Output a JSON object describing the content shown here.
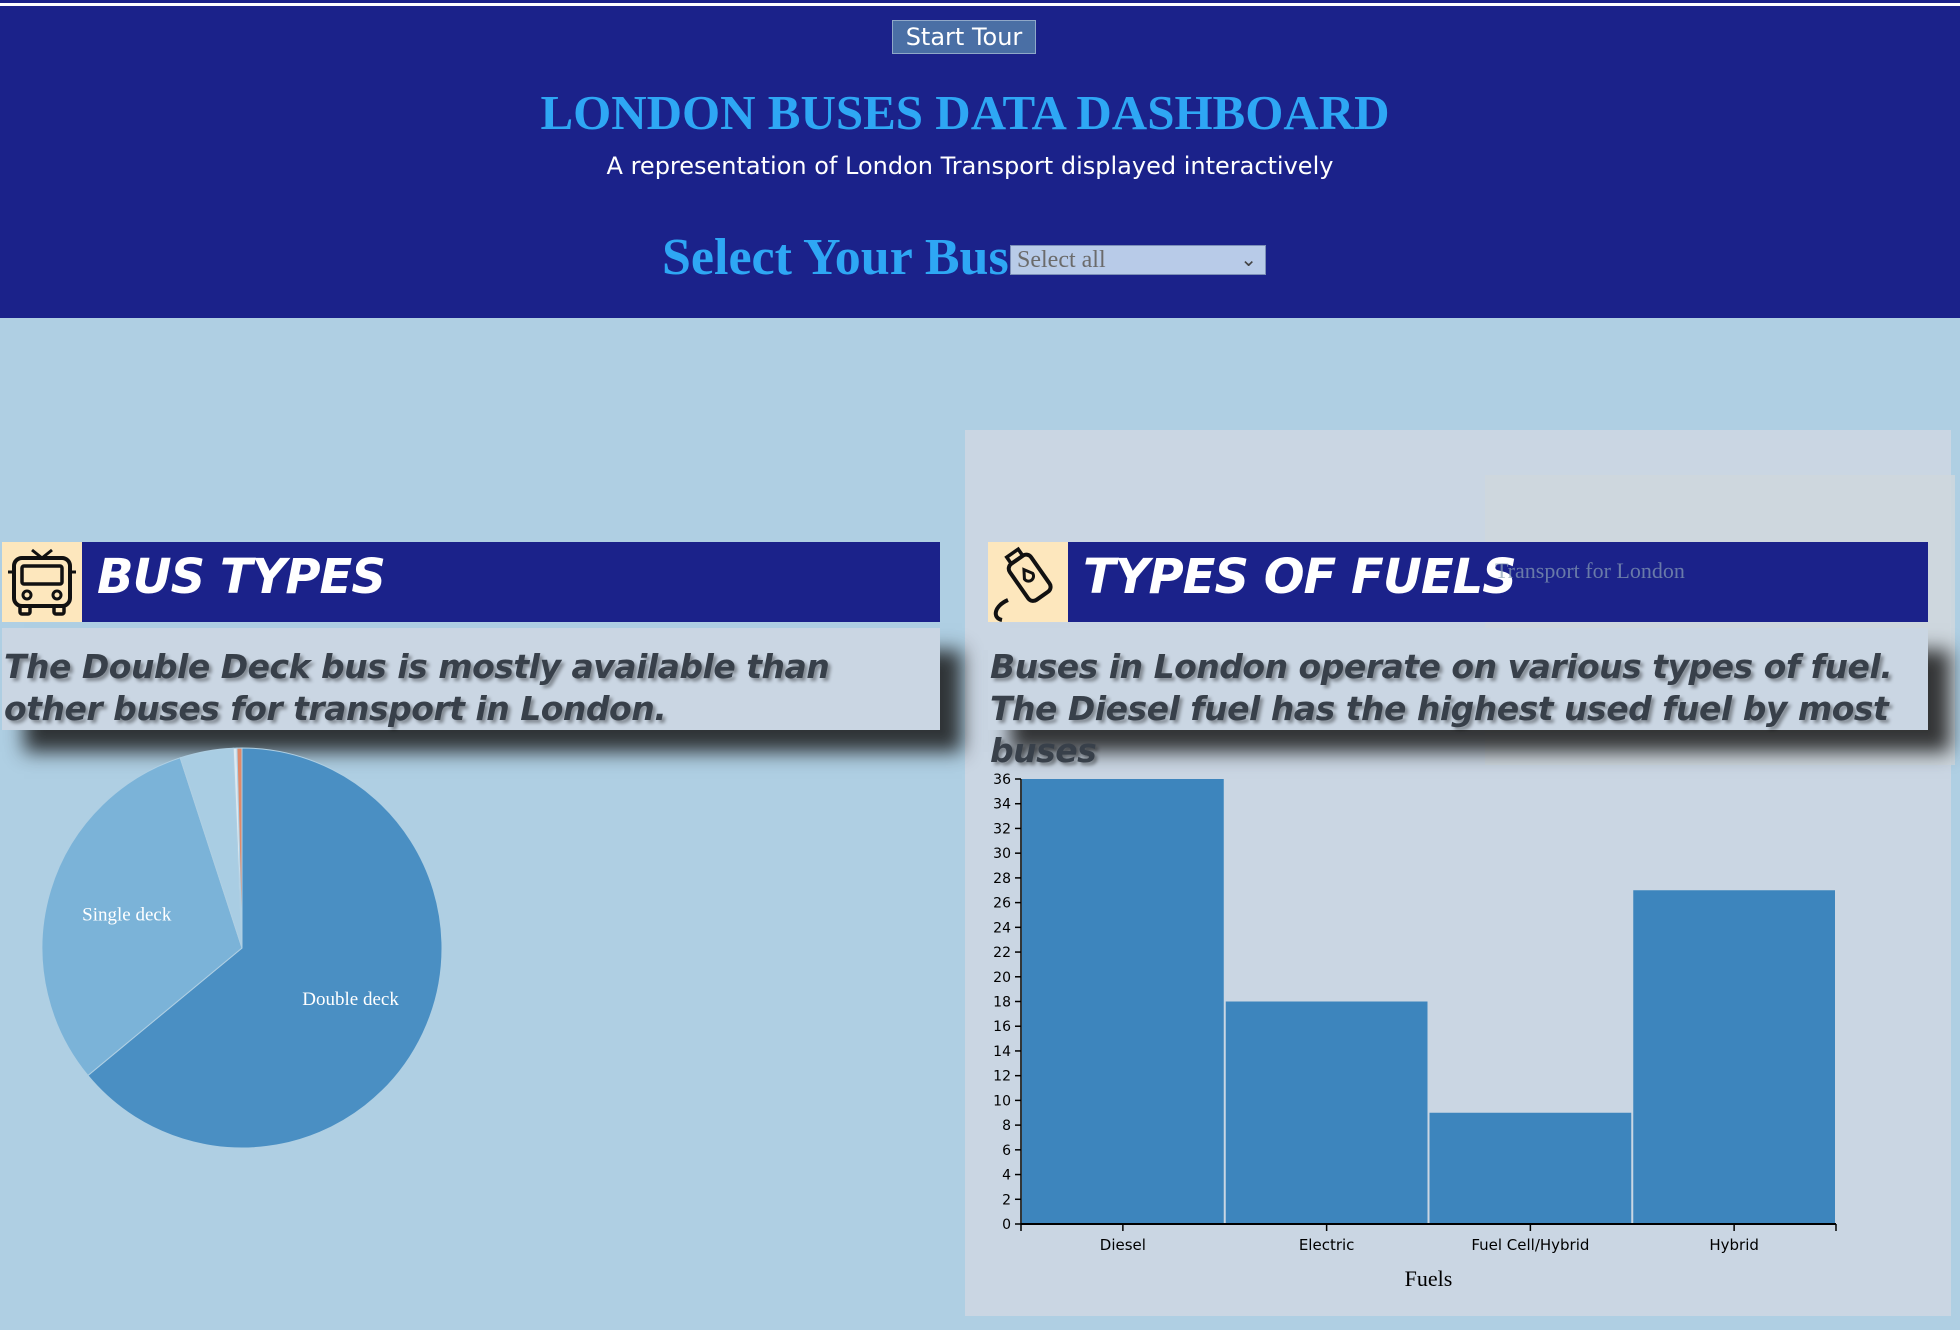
{
  "header": {
    "tour_button": "Start Tour",
    "title": "LONDON BUSES DATA DASHBOARD",
    "subtitle": "A representation of London Transport displayed interactively",
    "select_label": "Select Your Bus",
    "select_value": "Select all",
    "colors": {
      "background": "#1b228a",
      "title": "#2ea7f4"
    }
  },
  "watermark": {
    "text": "Transport for London"
  },
  "bus_types": {
    "heading": "BUS TYPES",
    "icon": "bus-icon",
    "description": "The Double Deck bus is mostly available than other buses for transport in London."
  },
  "fuels": {
    "heading": "TYPES OF FUELS",
    "icon": "fuel-pump-icon",
    "description": "Buses in London operate on various types of fuel. The Diesel fuel has the highest used fuel by most buses"
  },
  "chart_data": [
    {
      "type": "pie",
      "title": "",
      "slices": [
        {
          "label": "Double deck",
          "value": 64,
          "color": "#4a8fc3"
        },
        {
          "label": "Single deck",
          "value": 31,
          "color": "#7bb3d8"
        },
        {
          "label": "",
          "value": 4.3,
          "color": "#a9cde3"
        },
        {
          "label": "",
          "value": 0.3,
          "color": "#dde9f1"
        },
        {
          "label": "",
          "value": 0.4,
          "color": "#e08a6a"
        }
      ]
    },
    {
      "type": "bar",
      "title": "",
      "categories": [
        "Diesel",
        "Electric",
        "Fuel Cell/Hybrid",
        "Hybrid"
      ],
      "values": [
        36,
        18,
        9,
        27
      ],
      "xlabel": "Fuels",
      "ylabel": "",
      "ylim": [
        0,
        36
      ],
      "yticks": [
        "0",
        "2",
        "4",
        "6",
        "8",
        "10",
        "12",
        "14",
        "16",
        "18",
        "20",
        "22",
        "24",
        "26",
        "28",
        "30",
        "32",
        "34",
        "36"
      ],
      "bar_color": "#3d85bd"
    }
  ]
}
